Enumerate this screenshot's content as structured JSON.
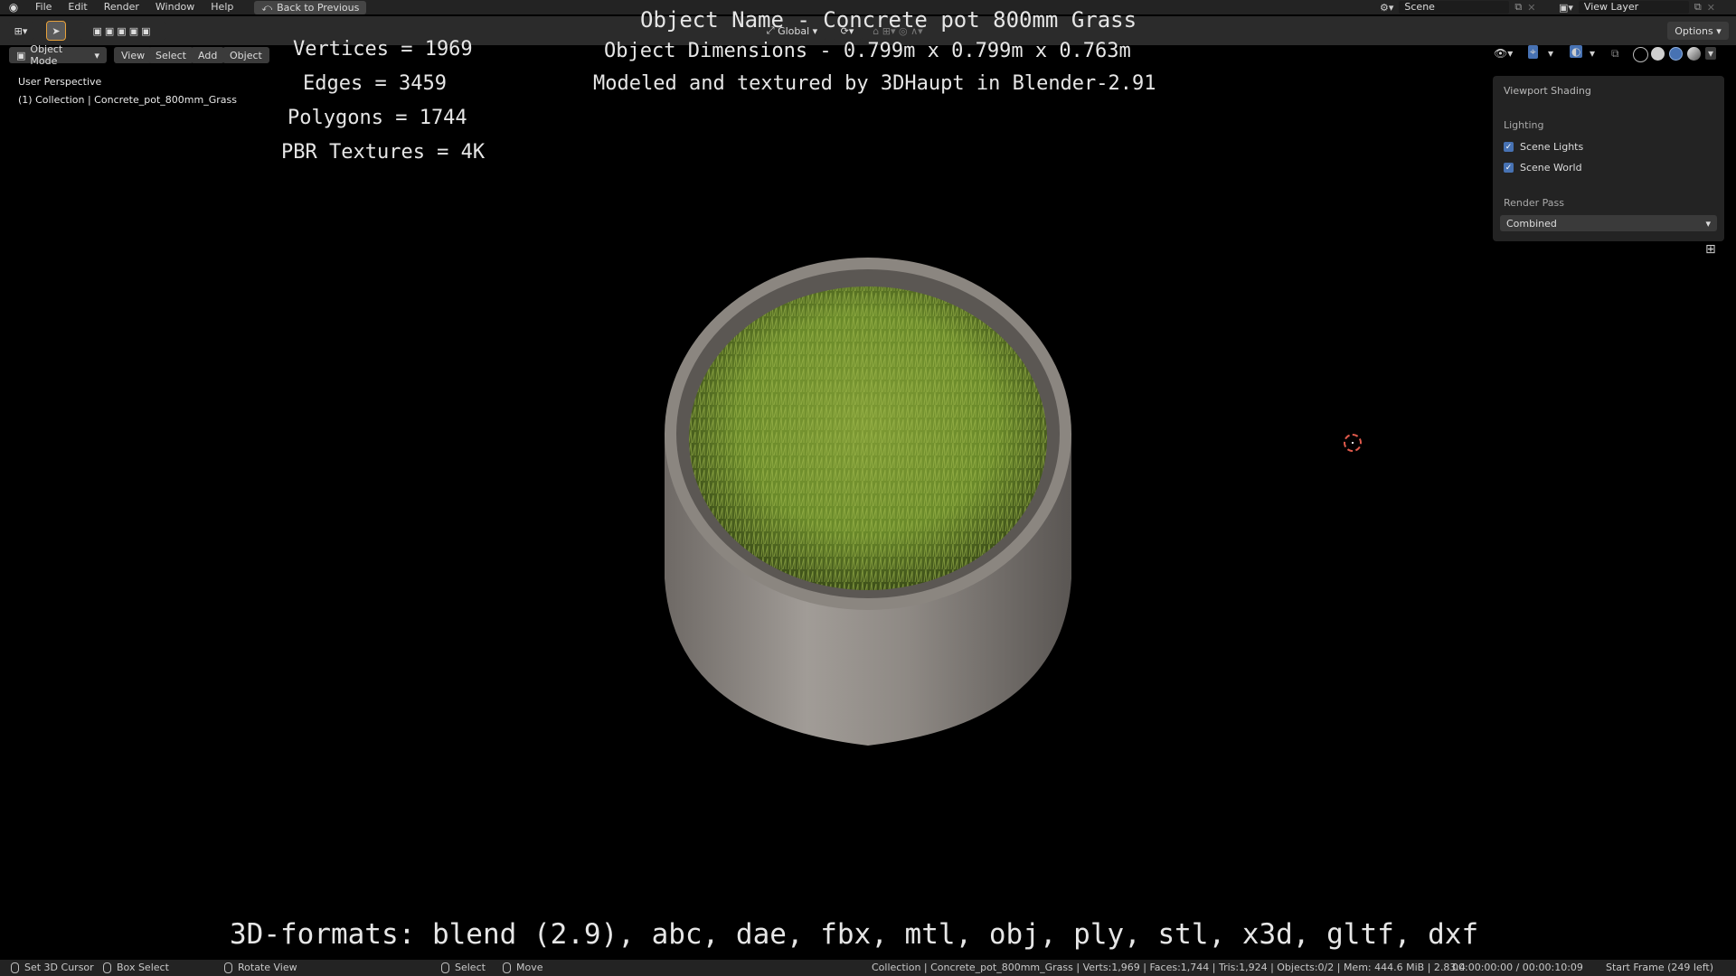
{
  "menu": {
    "items": [
      "File",
      "Edit",
      "Render",
      "Window",
      "Help"
    ],
    "back_button": "Back to Previous"
  },
  "scene": {
    "scene_name": "Scene",
    "view_layer": "View Layer"
  },
  "toolbar": {
    "transform_orientation": "Global",
    "options_label": "Options"
  },
  "header": {
    "mode": "Object Mode",
    "menus": [
      "View",
      "Select",
      "Add",
      "Object"
    ]
  },
  "viewport": {
    "perspective": "User Perspective",
    "collection": "(1) Collection | Concrete_pot_800mm_Grass"
  },
  "overlay": {
    "object_name": "Object Name - Concrete pot 800mm Grass",
    "dimensions": "Object Dimensions -  0.799m x 0.799m x 0.763m",
    "credit": "Modeled and textured by 3DHaupt in Blender-2.91",
    "vertices": "Vertices = 1969",
    "edges": "Edges = 3459",
    "polygons": "Polygons = 1744",
    "textures": "PBR Textures = 4K",
    "formats": "3D-formats: blend (2.9), abc, dae, fbx, mtl, obj, ply, stl, x3d, gltf, dxf"
  },
  "shading_popover": {
    "title": "Viewport Shading",
    "lighting_label": "Lighting",
    "scene_lights": "Scene Lights",
    "scene_world": "Scene World",
    "render_pass_label": "Render Pass",
    "render_pass_value": "Combined"
  },
  "status": {
    "set_cursor": "Set 3D Cursor",
    "box_select": "Box Select",
    "rotate_view": "Rotate View",
    "select": "Select",
    "move": "Move",
    "stats": "Collection | Concrete_pot_800mm_Grass | Verts:1,969 | Faces:1,744 | Tris:1,924 | Objects:0/2 | Mem: 444.6 MiB | 2.83.4",
    "time": "00:00:00:00 / 00:00:10:09",
    "frame": "Start Frame (249 left)"
  },
  "icons": [
    "blender-logo-icon",
    "back-icon",
    "select-tool-icon",
    "scene-icon",
    "view-layer-icon",
    "mouse-icon",
    "shading-solid-icon",
    "shading-material-icon",
    "shading-rendered-icon",
    "shading-wireframe-icon",
    "grid-icon"
  ],
  "colors": {
    "accent": "#4772b3",
    "cursor": "#e05a4c",
    "background": "#000000"
  }
}
